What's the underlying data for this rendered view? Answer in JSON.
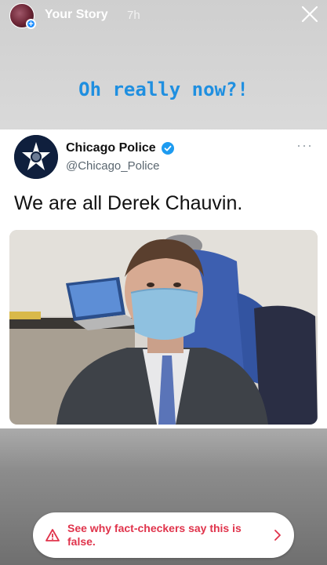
{
  "story": {
    "title": "Your Story",
    "time": "7h"
  },
  "caption": "Oh really now?!",
  "tweet": {
    "name": "Chicago Police",
    "handle": "@Chicago_Police",
    "text": "We are all Derek Chauvin.",
    "more": "···"
  },
  "fact_check": {
    "label": "See why fact-checkers say this is false."
  },
  "colors": {
    "caption": "#1f8fe0",
    "warning": "#e0334b",
    "verified": "#1d9bf0",
    "plus_badge": "#1a8cff"
  },
  "icons": {
    "close": "close-icon",
    "verified": "verified-badge-icon",
    "warning": "warning-triangle-icon",
    "chevron": "chevron-right-icon",
    "more": "more-dots-icon"
  }
}
